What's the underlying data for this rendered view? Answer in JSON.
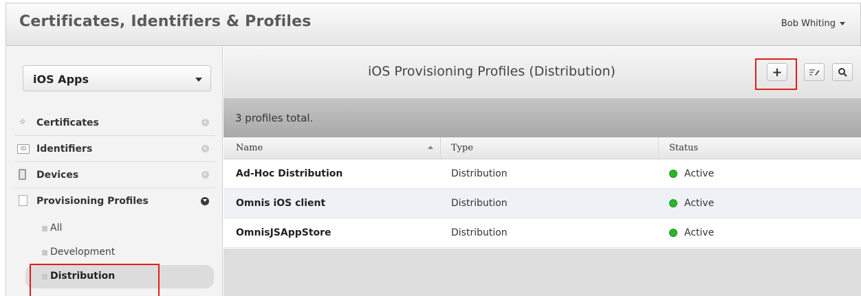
{
  "header": {
    "title": "Certificates, Identifiers & Profiles",
    "user": "Bob Whiting"
  },
  "sidebar": {
    "platform": "iOS Apps",
    "items": [
      {
        "label": "Certificates",
        "icon": "certificate-icon"
      },
      {
        "label": "Identifiers",
        "icon": "id-icon",
        "icon_text": "ID"
      },
      {
        "label": "Devices",
        "icon": "device-icon"
      },
      {
        "label": "Provisioning Profiles",
        "icon": "document-icon"
      }
    ],
    "sub_items": [
      {
        "label": "All"
      },
      {
        "label": "Development"
      },
      {
        "label": "Distribution",
        "selected": true
      }
    ]
  },
  "main": {
    "heading": "iOS Provisioning Profiles (Distribution)",
    "toolbar": {
      "add_icon": "plus-icon",
      "edit_icon": "edit-icon",
      "search_icon": "search-icon"
    },
    "summary": "3 profiles total.",
    "columns": [
      "Name",
      "Type",
      "Status"
    ],
    "rows": [
      {
        "name": "Ad-Hoc Distribution",
        "type": "Distribution",
        "status": "Active"
      },
      {
        "name": "Omnis iOS client",
        "type": "Distribution",
        "status": "Active"
      },
      {
        "name": "OmnisJSAppStore",
        "type": "Distribution",
        "status": "Active"
      }
    ]
  },
  "colors": {
    "highlight": "#e01b1b",
    "active_status": "#2bb52b"
  }
}
